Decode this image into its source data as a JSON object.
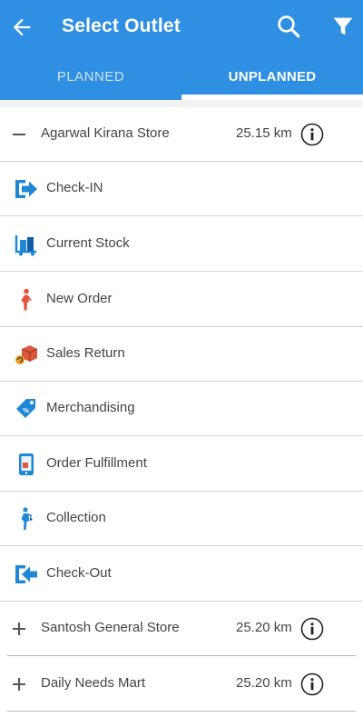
{
  "header": {
    "title": "Select Outlet",
    "icons": [
      "back-arrow-icon",
      "search-icon",
      "filter-icon"
    ]
  },
  "tabs": [
    {
      "label": "PLANNED",
      "active": false
    },
    {
      "label": "UNPLANNED",
      "active": true
    }
  ],
  "outlets": [
    {
      "name": "Agarwal Kirana Store",
      "distance": "25.15 km",
      "expanded": true
    },
    {
      "name": "Santosh General Store",
      "distance": "25.20 km",
      "expanded": false
    },
    {
      "name": "Daily Needs Mart",
      "distance": "25.20 km",
      "expanded": false
    }
  ],
  "actions": [
    {
      "label": "Check-IN",
      "icon": "check-in-icon"
    },
    {
      "label": "Current Stock",
      "icon": "current-stock-icon"
    },
    {
      "label": "New Order",
      "icon": "new-order-icon"
    },
    {
      "label": "Sales Return",
      "icon": "sales-return-icon"
    },
    {
      "label": "Merchandising",
      "icon": "merchandising-icon"
    },
    {
      "label": "Order Fulfillment",
      "icon": "order-fulfillment-icon"
    },
    {
      "label": "Collection",
      "icon": "collection-icon"
    },
    {
      "label": "Check-Out",
      "icon": "check-out-icon"
    }
  ],
  "colors": {
    "primary": "#2f8fe3",
    "icon_blue": "#1e88d6",
    "divider": "#d4d4d4"
  }
}
